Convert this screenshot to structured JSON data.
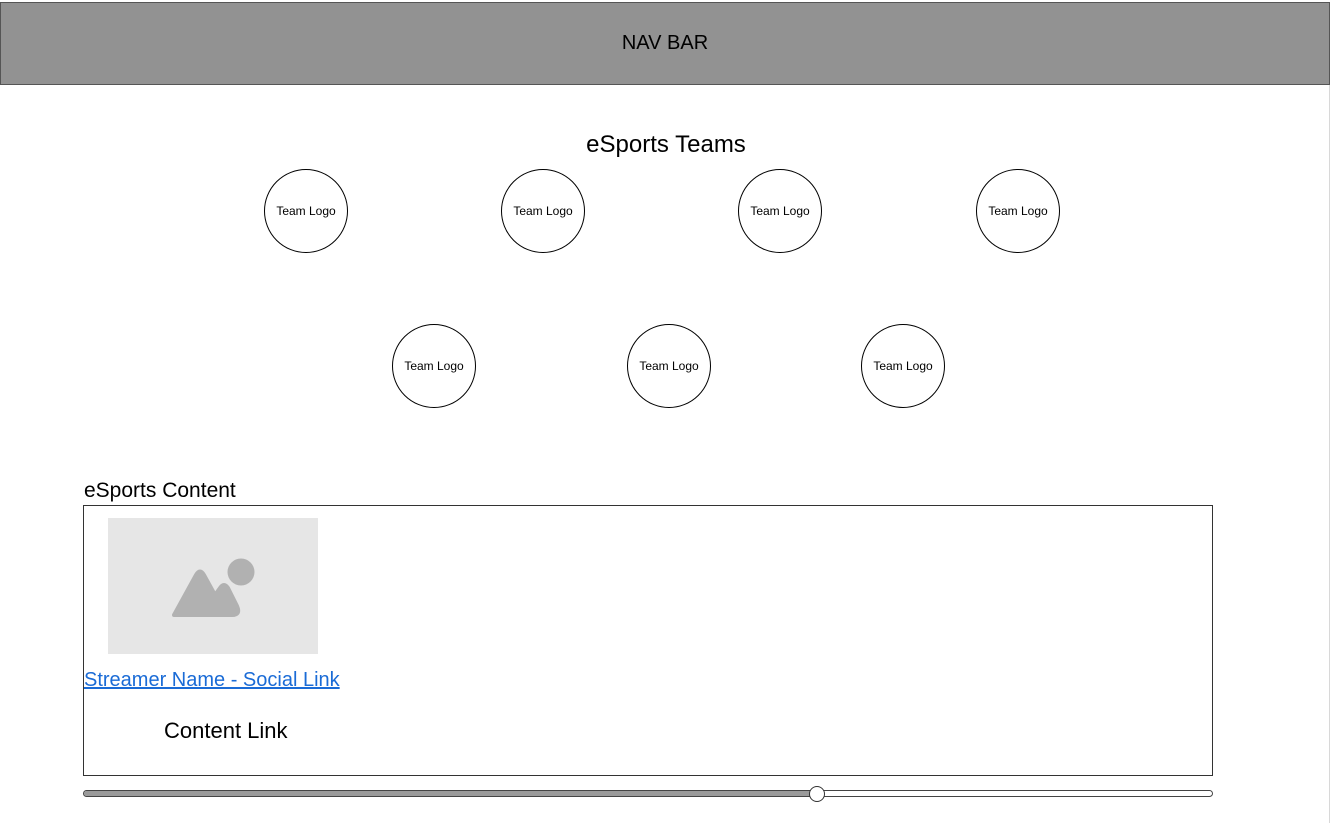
{
  "navbar": {
    "label": "NAV BAR"
  },
  "teams": {
    "title": "eSports Teams",
    "logos": [
      {
        "label": "Team Logo"
      },
      {
        "label": "Team Logo"
      },
      {
        "label": "Team Logo"
      },
      {
        "label": "Team Logo"
      },
      {
        "label": "Team Logo"
      },
      {
        "label": "Team Logo"
      },
      {
        "label": "Team Logo"
      }
    ]
  },
  "content": {
    "title": "eSports Content",
    "thumbnail_icon": "image-placeholder-icon",
    "social_link": "Streamer Name - Social Link",
    "content_link": "Content Link"
  },
  "carousel": {
    "position": 0.65
  },
  "colors": {
    "navbar_bg": "#929292",
    "link": "#1a6bd6",
    "placeholder_bg": "#e6e6e6",
    "placeholder_icon": "#b1b1b1"
  }
}
